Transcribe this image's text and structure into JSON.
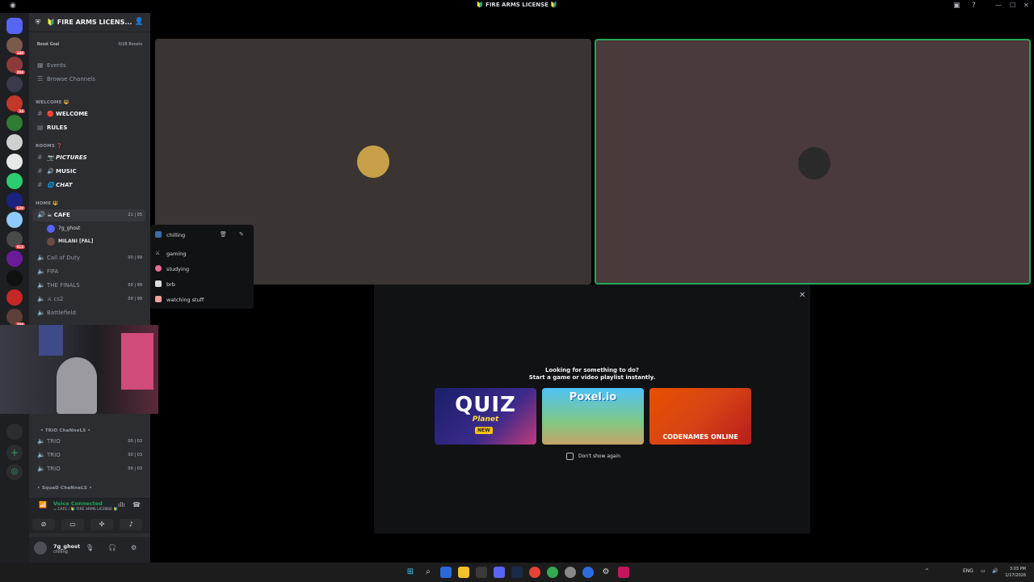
{
  "window": {
    "title": "🔰 FIRE ARMS LICENSE 🔰",
    "controls": [
      "—",
      "☐",
      "✕"
    ]
  },
  "server_rail": {
    "badges": [
      "148",
      "208",
      "",
      "",
      "34",
      "",
      "",
      "",
      "629",
      "913",
      "",
      "",
      "",
      "289"
    ]
  },
  "server": {
    "name": "🔰 FIRE ARMS LICENS...",
    "boost_goal_label": "Boost Goal",
    "boost_count": "0/28 Boosts",
    "events_label": "Events",
    "browse_label": "Browse Channels"
  },
  "categories": {
    "welcome": "WELCOME 🔱",
    "rooms": "ROOMS ❓",
    "home": "HOME 🔱",
    "trio": "• TRIO ChaNneLS •",
    "squad": "• SquaD ChaNneLS •"
  },
  "channels": {
    "welcome": "🔴 WELCOME",
    "rules": "RULES",
    "pictures": "📷 PICTURES",
    "music": "🔊 MUSIC",
    "chat": "🌐 CHAT",
    "cafe": "☕ CAFE",
    "cafe_counts": "21 | 05",
    "call_of_duty": "Call of Duty",
    "call_of_duty_counts": "00 | 99",
    "fifa": "FIFA",
    "the_finals": "THE FINALS",
    "the_finals_counts": "00 | 99",
    "cs2": "⚔ cs2",
    "cs2_counts": "00 | 99",
    "battlefield": "Battlefield",
    "trio1": "TRIO",
    "trio2": "TRIO",
    "trio3": "TRIO",
    "trio_counts": "00 | 03"
  },
  "members": [
    {
      "name": "7g_ghost"
    },
    {
      "name": "MILANI [FAL]"
    }
  ],
  "voice": {
    "status": "Voice Connected",
    "location": "☕ CAFE / 🔰 FIRE ARMS LICENSE 🔰"
  },
  "user": {
    "name": "7g_ghost",
    "status": "chilling"
  },
  "status_menu": {
    "current": "chilling",
    "items": [
      "gaming",
      "studying",
      "brb",
      "watching stuff"
    ]
  },
  "activity": {
    "line1": "Looking for something to do?",
    "line2": "Start a game or video playlist instantly.",
    "games": [
      "QUIZ",
      "Planet",
      "NEW",
      "Poxel.io",
      "CODENAMES ONLINE"
    ],
    "dont_show": "Don't show again"
  },
  "taskbar": {
    "lang": "ENG",
    "time": "3:03 PM",
    "date": "1/17/2026"
  },
  "colors": {
    "discord_dark": "#1e1f22",
    "sidebar": "#2b2d31",
    "accent_green": "#23a559",
    "tile_left": "#3a3533",
    "tile_right": "#4a3a3c"
  }
}
